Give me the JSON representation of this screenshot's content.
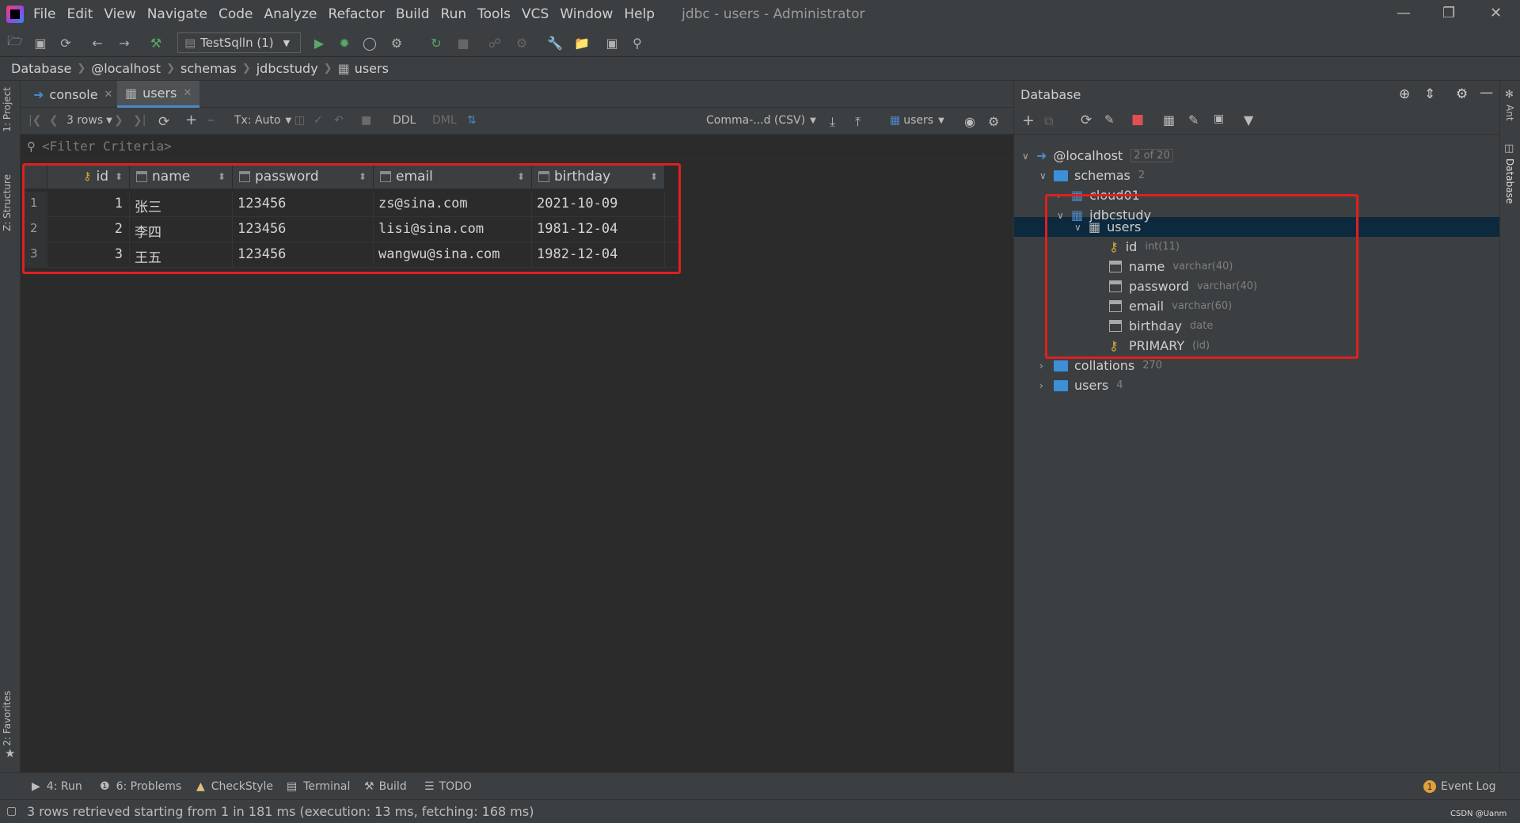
{
  "window": {
    "title": "jdbc - users - Administrator",
    "menu": [
      "File",
      "Edit",
      "View",
      "Navigate",
      "Code",
      "Analyze",
      "Refactor",
      "Build",
      "Run",
      "Tools",
      "VCS",
      "Window",
      "Help"
    ]
  },
  "toolbar": {
    "run_config": "TestSqlln (1)"
  },
  "breadcrumb": [
    "Database",
    "@localhost",
    "schemas",
    "jdbcstudy",
    "users"
  ],
  "left_strip": {
    "project": "1: Project",
    "structure": "Z: Structure",
    "favorites": "2: Favorites"
  },
  "editor": {
    "tabs": [
      {
        "label": "console"
      },
      {
        "label": "users"
      }
    ],
    "grid_toolbar": {
      "rows": "3 rows",
      "tx": "Tx: Auto",
      "ddl": "DDL",
      "dml": "DML",
      "export_format": "Comma-...d (CSV)",
      "target": "users"
    },
    "filter_placeholder": "<Filter Criteria>",
    "table": {
      "columns": [
        "id",
        "name",
        "password",
        "email",
        "birthday"
      ],
      "rows": [
        {
          "rownum": "1",
          "id": "1",
          "name": "张三",
          "password": "123456",
          "email": "zs@sina.com",
          "birthday": "2021-10-09"
        },
        {
          "rownum": "2",
          "id": "2",
          "name": "李四",
          "password": "123456",
          "email": "lisi@sina.com",
          "birthday": "1981-12-04"
        },
        {
          "rownum": "3",
          "id": "3",
          "name": "王五",
          "password": "123456",
          "email": "wangwu@sina.com",
          "birthday": "1982-12-04"
        }
      ]
    }
  },
  "database_panel": {
    "title": "Database",
    "tree": {
      "host": {
        "label": "@localhost",
        "badge": "2 of 20"
      },
      "schemas": {
        "label": "schemas",
        "count": "2"
      },
      "cloud01": "cloud01",
      "jdbcstudy": "jdbcstudy",
      "users_table": "users",
      "columns": [
        {
          "name": "id",
          "type": "int(11)"
        },
        {
          "name": "name",
          "type": "varchar(40)"
        },
        {
          "name": "password",
          "type": "varchar(40)"
        },
        {
          "name": "email",
          "type": "varchar(60)"
        },
        {
          "name": "birthday",
          "type": "date"
        }
      ],
      "primary": {
        "name": "PRIMARY",
        "type": "(id)"
      },
      "collations": {
        "label": "collations",
        "count": "270"
      },
      "users_group": {
        "label": "users",
        "count": "4"
      }
    }
  },
  "right_strip": {
    "ant": "Ant",
    "database": "Database"
  },
  "bottom_tools": [
    "4: Run",
    "6: Problems",
    "CheckStyle",
    "Terminal",
    "Build",
    "TODO"
  ],
  "event_log": {
    "label": "Event Log",
    "count": "1"
  },
  "status": {
    "message": "3 rows retrieved starting from 1 in 181 ms (execution: 13 ms, fetching: 168 ms)"
  },
  "watermark": "CSDN @Uanm",
  "colors": {
    "highlight_box": "#e01f1f",
    "selection": "#0d293e",
    "folder": "#3d8fd8",
    "run_green": "#59a869"
  }
}
